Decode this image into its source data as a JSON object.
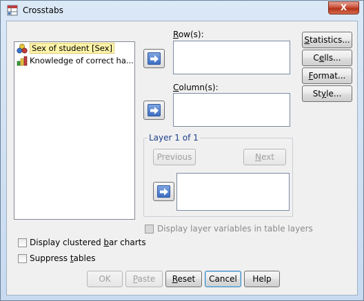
{
  "window": {
    "title": "Crosstabs",
    "close_label": "X"
  },
  "variables": [
    {
      "label": "Sex of student [Sex]",
      "icon": "nominal-icon",
      "selected": true
    },
    {
      "label": "Knowledge of correct ha...",
      "icon": "ordinal-icon",
      "selected": false
    }
  ],
  "rows": {
    "label_pre": "",
    "label_u": "R",
    "label_post": "ow(s):"
  },
  "columns": {
    "label_pre": "",
    "label_u": "C",
    "label_post": "olumn(s):"
  },
  "layer": {
    "title": "Layer 1 of 1",
    "previous_label": "Previous",
    "next_pre": "",
    "next_u": "N",
    "next_post": "ext"
  },
  "side_buttons": {
    "statistics": {
      "pre": "",
      "u": "S",
      "post": "tatistics..."
    },
    "cells": {
      "pre": "C",
      "u": "e",
      "post": "lls..."
    },
    "format": {
      "pre": "",
      "u": "F",
      "post": "ormat..."
    },
    "style": {
      "pre": "St",
      "u": "y",
      "post": "le..."
    }
  },
  "options": {
    "display_layer": {
      "label": "Display layer variables in table layers",
      "checked": false,
      "disabled": true
    },
    "clustered": {
      "pre": "Display clustered ",
      "u": "b",
      "post": "ar charts",
      "checked": false
    },
    "suppress": {
      "pre": "Suppress ",
      "u": "t",
      "post": "ables",
      "checked": false
    }
  },
  "footer": {
    "ok": "OK",
    "paste_pre": "",
    "paste_u": "P",
    "paste_post": "aste",
    "reset_pre": "",
    "reset_u": "R",
    "reset_post": "eset",
    "cancel": "Cancel",
    "help": "Help"
  }
}
